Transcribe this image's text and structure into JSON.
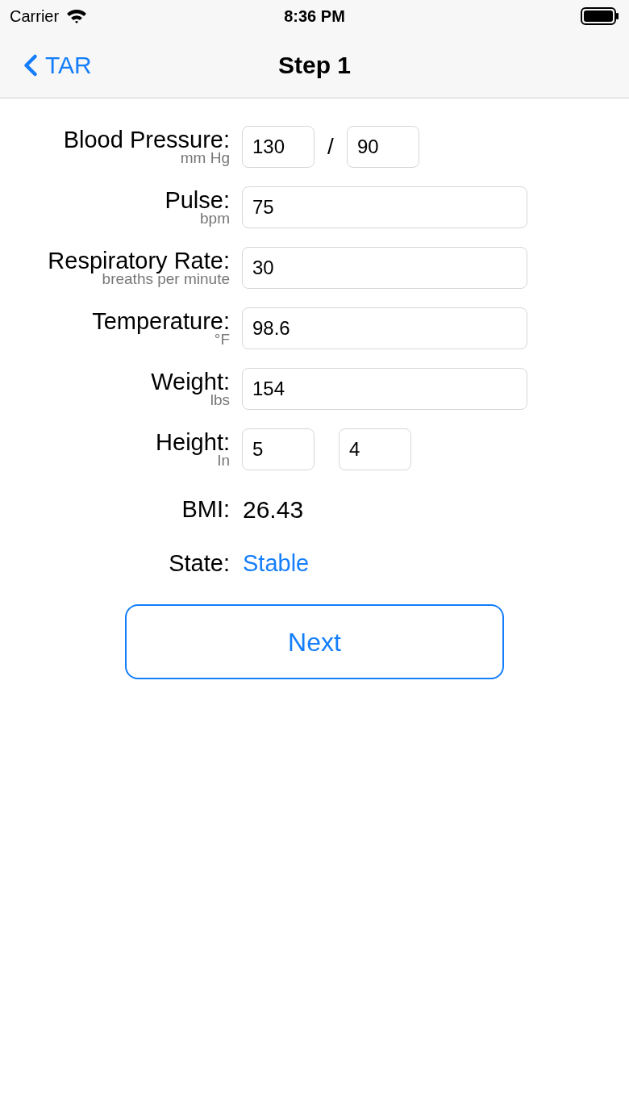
{
  "status_bar": {
    "carrier": "Carrier",
    "time": "8:36 PM"
  },
  "nav": {
    "back": "TAR",
    "title": "Step 1"
  },
  "fields": [
    {
      "kind": "pair",
      "label": "Blood Pressure:",
      "unit": "mm Hg",
      "values": [
        "130",
        "90"
      ],
      "separator": "/"
    },
    {
      "kind": "single",
      "label": "Pulse:",
      "unit": "bpm",
      "values": [
        "75"
      ]
    },
    {
      "kind": "single",
      "label": "Respiratory Rate:",
      "unit": "breaths per minute",
      "values": [
        "30"
      ]
    },
    {
      "kind": "single",
      "label": "Temperature:",
      "unit": "°F",
      "values": [
        "98.6"
      ]
    },
    {
      "kind": "single",
      "label": "Weight:",
      "unit": "lbs",
      "values": [
        "154"
      ]
    },
    {
      "kind": "pair",
      "label": "Height:",
      "unit": "In",
      "values": [
        "5",
        "4"
      ]
    }
  ],
  "bmi": {
    "label": "BMI:",
    "value": "26.43"
  },
  "state": {
    "label": "State:",
    "value": "Stable"
  },
  "next_button": "Next"
}
